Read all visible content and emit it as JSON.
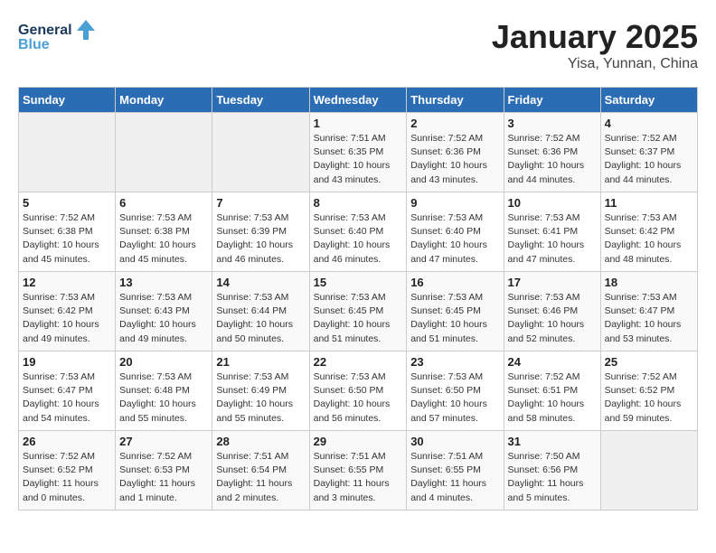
{
  "header": {
    "logo_line1": "General",
    "logo_line2": "Blue",
    "title": "January 2025",
    "subtitle": "Yisa, Yunnan, China"
  },
  "calendar": {
    "days_of_week": [
      "Sunday",
      "Monday",
      "Tuesday",
      "Wednesday",
      "Thursday",
      "Friday",
      "Saturday"
    ],
    "weeks": [
      [
        {
          "day": "",
          "info": ""
        },
        {
          "day": "",
          "info": ""
        },
        {
          "day": "",
          "info": ""
        },
        {
          "day": "1",
          "info": "Sunrise: 7:51 AM\nSunset: 6:35 PM\nDaylight: 10 hours\nand 43 minutes."
        },
        {
          "day": "2",
          "info": "Sunrise: 7:52 AM\nSunset: 6:36 PM\nDaylight: 10 hours\nand 43 minutes."
        },
        {
          "day": "3",
          "info": "Sunrise: 7:52 AM\nSunset: 6:36 PM\nDaylight: 10 hours\nand 44 minutes."
        },
        {
          "day": "4",
          "info": "Sunrise: 7:52 AM\nSunset: 6:37 PM\nDaylight: 10 hours\nand 44 minutes."
        }
      ],
      [
        {
          "day": "5",
          "info": "Sunrise: 7:52 AM\nSunset: 6:38 PM\nDaylight: 10 hours\nand 45 minutes."
        },
        {
          "day": "6",
          "info": "Sunrise: 7:53 AM\nSunset: 6:38 PM\nDaylight: 10 hours\nand 45 minutes."
        },
        {
          "day": "7",
          "info": "Sunrise: 7:53 AM\nSunset: 6:39 PM\nDaylight: 10 hours\nand 46 minutes."
        },
        {
          "day": "8",
          "info": "Sunrise: 7:53 AM\nSunset: 6:40 PM\nDaylight: 10 hours\nand 46 minutes."
        },
        {
          "day": "9",
          "info": "Sunrise: 7:53 AM\nSunset: 6:40 PM\nDaylight: 10 hours\nand 47 minutes."
        },
        {
          "day": "10",
          "info": "Sunrise: 7:53 AM\nSunset: 6:41 PM\nDaylight: 10 hours\nand 47 minutes."
        },
        {
          "day": "11",
          "info": "Sunrise: 7:53 AM\nSunset: 6:42 PM\nDaylight: 10 hours\nand 48 minutes."
        }
      ],
      [
        {
          "day": "12",
          "info": "Sunrise: 7:53 AM\nSunset: 6:42 PM\nDaylight: 10 hours\nand 49 minutes."
        },
        {
          "day": "13",
          "info": "Sunrise: 7:53 AM\nSunset: 6:43 PM\nDaylight: 10 hours\nand 49 minutes."
        },
        {
          "day": "14",
          "info": "Sunrise: 7:53 AM\nSunset: 6:44 PM\nDaylight: 10 hours\nand 50 minutes."
        },
        {
          "day": "15",
          "info": "Sunrise: 7:53 AM\nSunset: 6:45 PM\nDaylight: 10 hours\nand 51 minutes."
        },
        {
          "day": "16",
          "info": "Sunrise: 7:53 AM\nSunset: 6:45 PM\nDaylight: 10 hours\nand 51 minutes."
        },
        {
          "day": "17",
          "info": "Sunrise: 7:53 AM\nSunset: 6:46 PM\nDaylight: 10 hours\nand 52 minutes."
        },
        {
          "day": "18",
          "info": "Sunrise: 7:53 AM\nSunset: 6:47 PM\nDaylight: 10 hours\nand 53 minutes."
        }
      ],
      [
        {
          "day": "19",
          "info": "Sunrise: 7:53 AM\nSunset: 6:47 PM\nDaylight: 10 hours\nand 54 minutes."
        },
        {
          "day": "20",
          "info": "Sunrise: 7:53 AM\nSunset: 6:48 PM\nDaylight: 10 hours\nand 55 minutes."
        },
        {
          "day": "21",
          "info": "Sunrise: 7:53 AM\nSunset: 6:49 PM\nDaylight: 10 hours\nand 55 minutes."
        },
        {
          "day": "22",
          "info": "Sunrise: 7:53 AM\nSunset: 6:50 PM\nDaylight: 10 hours\nand 56 minutes."
        },
        {
          "day": "23",
          "info": "Sunrise: 7:53 AM\nSunset: 6:50 PM\nDaylight: 10 hours\nand 57 minutes."
        },
        {
          "day": "24",
          "info": "Sunrise: 7:52 AM\nSunset: 6:51 PM\nDaylight: 10 hours\nand 58 minutes."
        },
        {
          "day": "25",
          "info": "Sunrise: 7:52 AM\nSunset: 6:52 PM\nDaylight: 10 hours\nand 59 minutes."
        }
      ],
      [
        {
          "day": "26",
          "info": "Sunrise: 7:52 AM\nSunset: 6:52 PM\nDaylight: 11 hours\nand 0 minutes."
        },
        {
          "day": "27",
          "info": "Sunrise: 7:52 AM\nSunset: 6:53 PM\nDaylight: 11 hours\nand 1 minute."
        },
        {
          "day": "28",
          "info": "Sunrise: 7:51 AM\nSunset: 6:54 PM\nDaylight: 11 hours\nand 2 minutes."
        },
        {
          "day": "29",
          "info": "Sunrise: 7:51 AM\nSunset: 6:55 PM\nDaylight: 11 hours\nand 3 minutes."
        },
        {
          "day": "30",
          "info": "Sunrise: 7:51 AM\nSunset: 6:55 PM\nDaylight: 11 hours\nand 4 minutes."
        },
        {
          "day": "31",
          "info": "Sunrise: 7:50 AM\nSunset: 6:56 PM\nDaylight: 11 hours\nand 5 minutes."
        },
        {
          "day": "",
          "info": ""
        }
      ]
    ]
  }
}
